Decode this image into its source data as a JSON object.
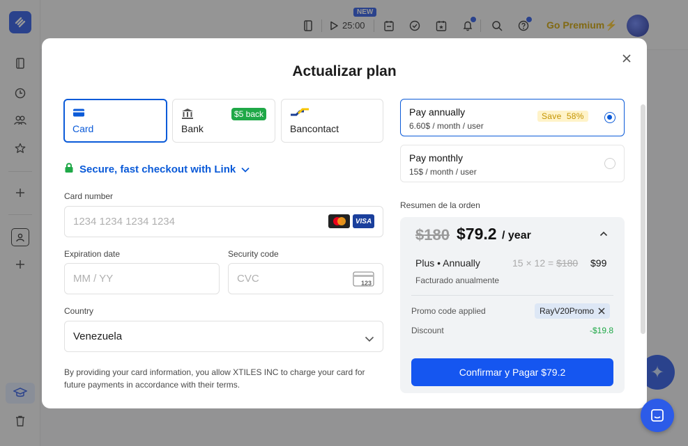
{
  "background": {
    "topbar": {
      "new_badge": "NEW",
      "timer": "25:00",
      "premium_label": "Go Premium"
    },
    "icons": [
      "logo-icon",
      "pages-icon",
      "clock-icon",
      "users-icon",
      "star-icon",
      "plus-icon",
      "contact-icon",
      "plus-icon",
      "graduation-icon",
      "trash-icon",
      "book-icon",
      "play-icon",
      "calendar-icon",
      "check-circle-icon",
      "calendar-event-icon",
      "bell-icon",
      "search-icon",
      "help-icon",
      "sparkle-icon",
      "chat-icon"
    ]
  },
  "modal": {
    "title": "Actualizar plan",
    "payment_methods": [
      {
        "label": "Card",
        "active": true,
        "icon": "card-icon"
      },
      {
        "label": "Bank",
        "active": false,
        "icon": "bank-icon",
        "badge": "$5 back"
      },
      {
        "label": "Bancontact",
        "active": false,
        "icon": "bancontact-icon"
      }
    ],
    "link_text": "Secure, fast checkout with Link",
    "card_number": {
      "label": "Card number",
      "placeholder": "1234 1234 1234 1234"
    },
    "expiration": {
      "label": "Expiration date",
      "placeholder": "MM / YY"
    },
    "security": {
      "label": "Security code",
      "placeholder": "CVC",
      "card_hint": "123"
    },
    "country": {
      "label": "Country",
      "value": "Venezuela"
    },
    "disclaimer": "By providing your card information, you allow XTILES INC to charge your card for future payments in accordance with their terms.",
    "plans": [
      {
        "name": "Pay annually",
        "sub": "6.60$ / month / user",
        "badge": "Save  58%",
        "selected": true
      },
      {
        "name": "Pay monthly",
        "sub": "15$ / month / user",
        "selected": false
      }
    ],
    "summary": {
      "label": "Resumen de la orden",
      "old_price": "$180",
      "new_price": "$79.2",
      "period": "/ year",
      "line_item": "Plus • Annually",
      "calc_prefix": "15 × 12 =",
      "calc_strike": "$180",
      "line_total": "$99",
      "billing_note": "Facturado anualmente",
      "promo_label": "Promo code applied",
      "promo_code": "RayV20Promo",
      "discount_label": "Discount",
      "discount_value": "-$19.8",
      "pay_button": "Confirmar y Pagar $79.2"
    }
  },
  "colors": {
    "primary": "#1556f0",
    "link": "#0a5ad8",
    "success": "#1fa847",
    "premium": "#d4a500"
  }
}
